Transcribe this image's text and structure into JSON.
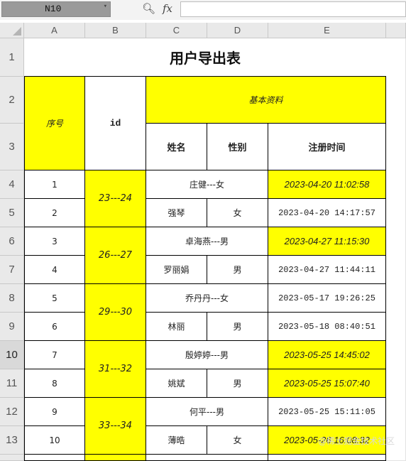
{
  "formula_bar": {
    "name_box": "N10",
    "fx_label": "fx",
    "zoom_icon": "magnifier-icon",
    "formula": ""
  },
  "columns": [
    "A",
    "B",
    "C",
    "D",
    "E"
  ],
  "rows": [
    "1",
    "2",
    "3",
    "4",
    "5",
    "6",
    "7",
    "8",
    "9",
    "10",
    "11",
    "12",
    "13"
  ],
  "sheet": {
    "title": "用户导出表",
    "headers": {
      "seq": "序号",
      "id": "id",
      "basic_info": "基本资料",
      "name": "姓名",
      "gender": "性别",
      "reg_time": "注册时间"
    },
    "records": [
      {
        "seq": "1",
        "id_group": "23---24",
        "name_merged": "庄健---女",
        "reg_time": "2023-04-20 11:02:58"
      },
      {
        "seq": "2",
        "name": "强琴",
        "gender": "女",
        "reg_time": "2023-04-20 14:17:57"
      },
      {
        "seq": "3",
        "id_group": "26---27",
        "name_merged": "卓海燕---男",
        "reg_time": "2023-04-27 11:15:30"
      },
      {
        "seq": "4",
        "name": "罗丽娟",
        "gender": "男",
        "reg_time": "2023-04-27 11:44:11"
      },
      {
        "seq": "5",
        "id_group": "29---30",
        "name_merged": "乔丹丹---女",
        "reg_time": "2023-05-17 19:26:25"
      },
      {
        "seq": "6",
        "name": "林丽",
        "gender": "男",
        "reg_time": "2023-05-18 08:40:51"
      },
      {
        "seq": "7",
        "id_group": "31---32",
        "name_merged": "殷婷婷---男",
        "reg_time": "2023-05-25 14:45:02"
      },
      {
        "seq": "8",
        "name": "姚斌",
        "gender": "男",
        "reg_time": "2023-05-25 15:07:40"
      },
      {
        "seq": "9",
        "id_group": "33---34",
        "name_merged": "何平---男",
        "reg_time": "2023-05-25 15:11:05"
      },
      {
        "seq": "10",
        "name": "薄晧",
        "gender": "女",
        "reg_time": "2023-05-26 16:08:32"
      }
    ]
  },
  "watermark": "@稀土掘金技术社区",
  "colors": {
    "highlight": "#ffff00",
    "header_bg": "#e9e9e9"
  }
}
